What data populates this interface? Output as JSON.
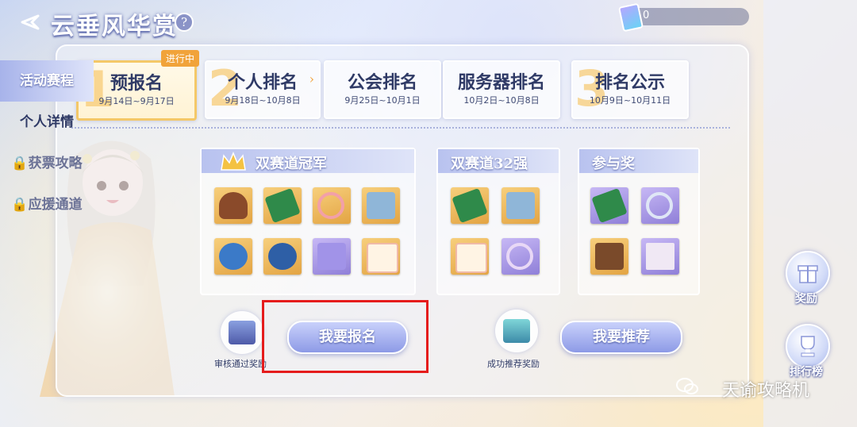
{
  "header": {
    "title": "云垂风华赏",
    "help": "?",
    "ticket_count": "0"
  },
  "stages": [
    {
      "num": "1",
      "name": "预报名",
      "date": "9月14日~9月17日",
      "badge": "进行中"
    },
    {
      "num": "2",
      "name": "个人排名",
      "date": "9月18日~10月8日"
    },
    {
      "num": "",
      "name": "公会排名",
      "date": "9月25日~10月1日"
    },
    {
      "num": "",
      "name": "服务器排名",
      "date": "10月2日~10月8日"
    },
    {
      "num": "3",
      "name": "排名公示",
      "date": "10月9日~10月11日"
    }
  ],
  "groups": [
    {
      "title": "双赛道冠军"
    },
    {
      "title": "双赛道32强"
    },
    {
      "title": "参与奖"
    }
  ],
  "actions": {
    "chest1_label": "审核通过奖励",
    "signup_button": "我要报名",
    "chest2_label": "成功推荐奖励",
    "recommend_button": "我要推荐"
  },
  "sidebar": {
    "items": [
      {
        "label": "活动赛程"
      },
      {
        "label": "个人详情"
      },
      {
        "label": "🔒获票攻略"
      },
      {
        "label": "🔒应援通道"
      }
    ],
    "reward_label": "奖励",
    "ranking_label": "排行榜"
  },
  "watermark": "天谕攻略机",
  "colors": {
    "accent": "#f4c868",
    "highlight_box": "#e51c1c",
    "button": "#8d9ae6"
  }
}
